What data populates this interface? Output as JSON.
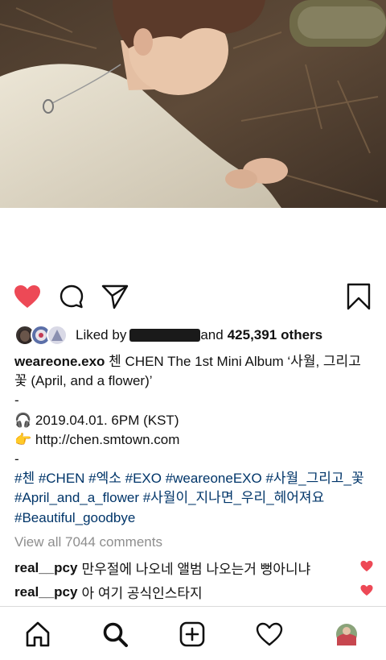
{
  "post": {
    "liked_by_prefix": "Liked by",
    "liked_by_connector": "and",
    "likes_count": "425,391",
    "likes_suffix": "others",
    "author": "weareone.exo",
    "caption_line1": " 첸 CHEN The 1st Mini Album ‘사월, 그리고 꽃 (April, and a flower)’",
    "dash": "-",
    "date_line": "🎧 2019.04.01. 6PM (KST)",
    "url_line": "👉 http://chen.smtown.com",
    "hashtags": "#첸 #CHEN #엑소 #EXO #weareoneEXO #사월_그리고_꽃 #April_and_a_flower #사월이_지나면_우리_헤어져요 #Beautiful_goodbye",
    "view_all_comments": "View all 7044 comments",
    "liked": true,
    "like_color": "#ed4956"
  },
  "comments": [
    {
      "user": "real__pcy",
      "text": "만우절에 나오네 앨범 나오는거 뻥아니냐"
    },
    {
      "user": "real__pcy",
      "text": "아 여기 공식인스타지"
    }
  ],
  "icons": {
    "like": "heart-icon",
    "comment": "comment-bubble-icon",
    "share": "paper-plane-icon",
    "save": "bookmark-icon"
  },
  "nav": {
    "items": [
      "home-icon",
      "search-icon",
      "add-post-icon",
      "activity-heart-icon",
      "profile-avatar"
    ]
  }
}
